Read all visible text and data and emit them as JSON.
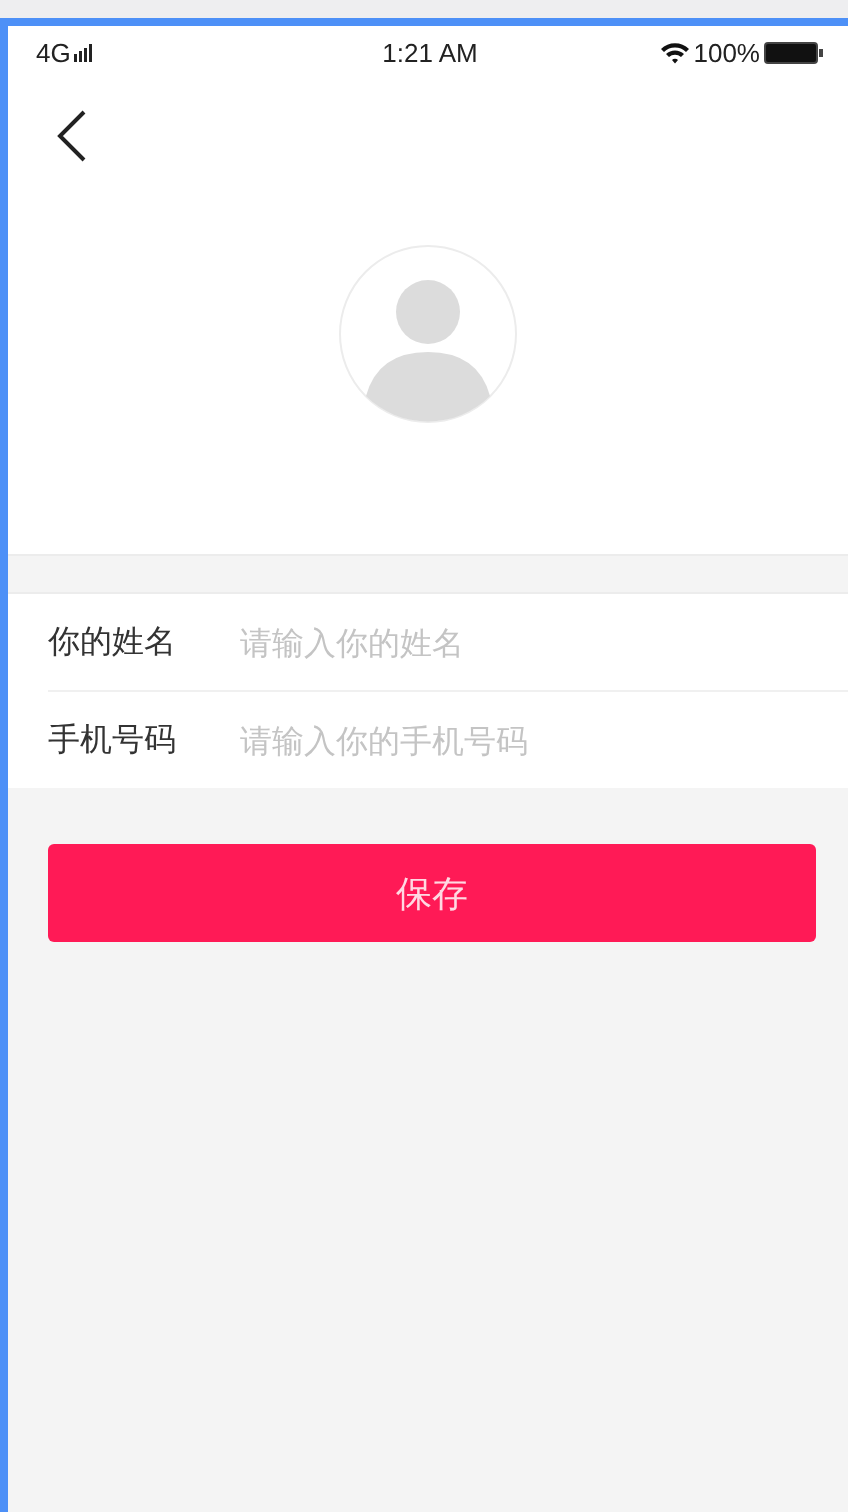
{
  "status_bar": {
    "network": "4G",
    "time": "1:21 AM",
    "battery": "100%"
  },
  "form": {
    "fields": [
      {
        "label": "你的姓名",
        "placeholder": "请输入你的姓名"
      },
      {
        "label": "手机号码",
        "placeholder": "请输入你的手机号码"
      }
    ]
  },
  "buttons": [
    "保存"
  ]
}
